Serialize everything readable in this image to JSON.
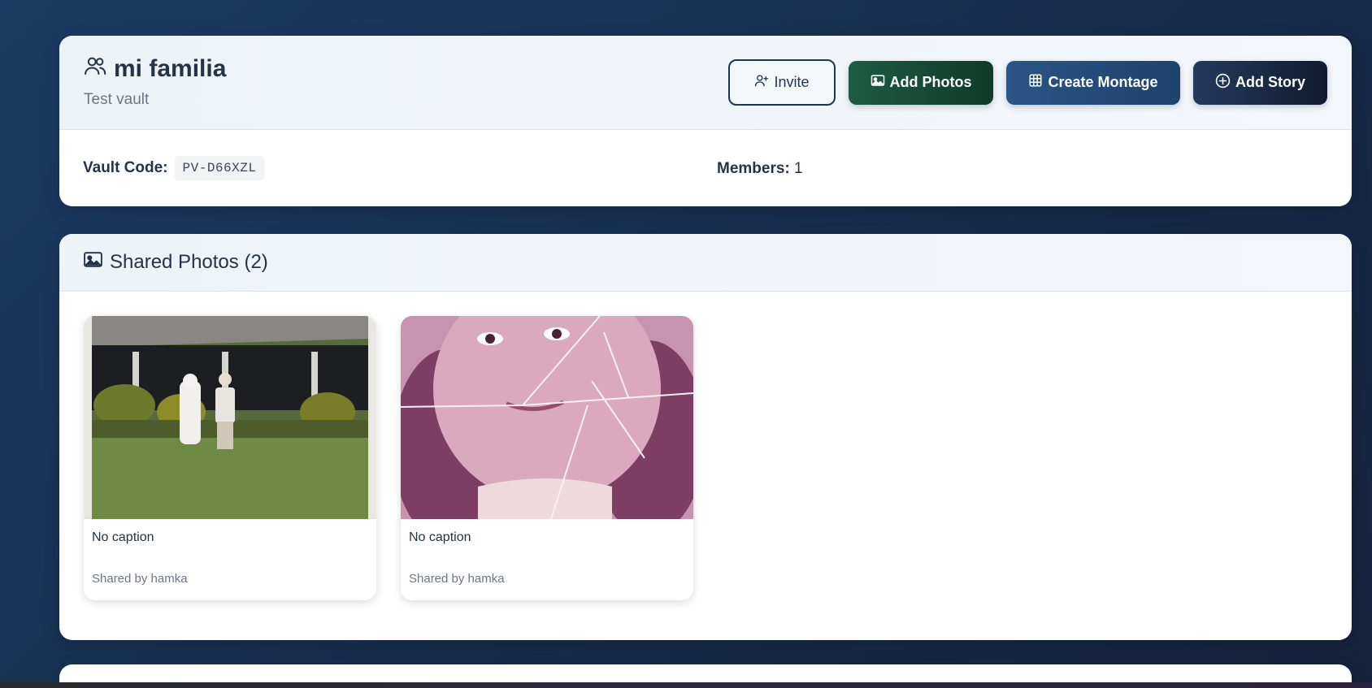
{
  "vault": {
    "title": "mi familia",
    "subtitle": "Test vault",
    "buttons": {
      "invite": "Invite",
      "add_photos": "Add Photos",
      "create_montage": "Create Montage",
      "add_story": "Add Story"
    },
    "code_label": "Vault Code:",
    "code_value": "PV-D66XZL",
    "members_label": "Members:",
    "members_value": "1"
  },
  "photos": {
    "heading": "Shared Photos (2)",
    "items": [
      {
        "caption": "No caption",
        "shared_by": "Shared by hamka"
      },
      {
        "caption": "No caption",
        "shared_by": "Shared by hamka"
      }
    ]
  },
  "colors": {
    "invite_border": "#1e3656",
    "add_photos": "#1e5b45",
    "create_montage": "#2b5586",
    "add_story": "#1a2a44"
  }
}
